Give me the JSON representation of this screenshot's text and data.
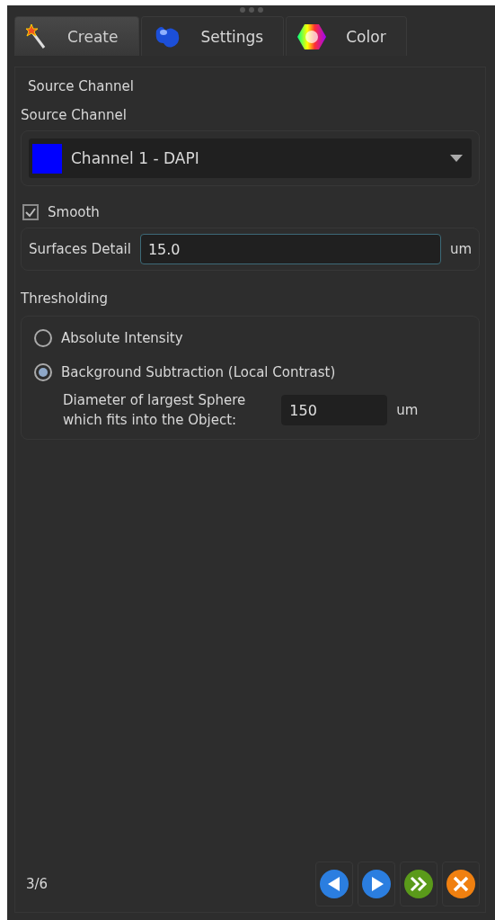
{
  "tabs": [
    {
      "label": "Create",
      "selected": true,
      "kind": "wand"
    },
    {
      "label": "Settings",
      "selected": false,
      "kind": "blob"
    },
    {
      "label": "Color",
      "selected": false,
      "kind": "hexagon"
    }
  ],
  "title": "Source Channel",
  "source_channel": {
    "label": "Source Channel",
    "value": "Channel 1 - DAPI",
    "color": "#0000ff"
  },
  "smooth": {
    "label": "Smooth",
    "checked": true
  },
  "surfaces_detail": {
    "label": "Surfaces Detail",
    "value": "15.0",
    "unit": "um"
  },
  "thresholding": {
    "label": "Thresholding",
    "options": [
      {
        "label": "Absolute Intensity",
        "selected": false
      },
      {
        "label": "Background Subtraction (Local Contrast)",
        "selected": true
      }
    ],
    "diameter": {
      "label_lines": [
        "Diameter of largest Sphere",
        "which fits into the Object:"
      ],
      "value": "150",
      "unit": "um"
    }
  },
  "footer": {
    "step": "3/6",
    "buttons": [
      {
        "kind": "back"
      },
      {
        "kind": "next"
      },
      {
        "kind": "finish"
      },
      {
        "kind": "cancel"
      }
    ]
  }
}
